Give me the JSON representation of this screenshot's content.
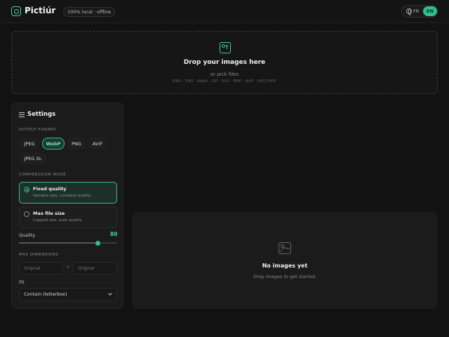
{
  "header": {
    "app_title": "Pictiúr",
    "badge": "100% local · offline",
    "lang_fr": "FR",
    "lang_en": "EN",
    "active_lang": "EN",
    "accent_color": "#2fbf8e"
  },
  "dropzone": {
    "title": "Drop your images here",
    "subtitle": "or pick files",
    "formats": "JPEG · PNG · WebP · GIF · SVG · BMP · AVIF · HEIC/HEIF",
    "icon": "image-upload-icon"
  },
  "settings": {
    "title": "Settings",
    "output_format_label": "OUTPUT FORMAT",
    "formats": [
      "JPEG",
      "WebP",
      "PNG",
      "AVIF",
      "JPEG XL"
    ],
    "selected_format": "WebP",
    "compression_mode_label": "COMPRESSION MODE",
    "modes": [
      {
        "title": "Fixed quality",
        "desc": "Variable size, constant quality",
        "selected": true
      },
      {
        "title": "Max file size",
        "desc": "Capped size, auto quality",
        "selected": false
      }
    ],
    "quality_label": "Quality",
    "quality_value": "80",
    "quality_fraction": 0.8,
    "max_dimensions_label": "MAX DIMENSIONS",
    "width_placeholder": "Original",
    "height_placeholder": "Original",
    "dim_separator": "×",
    "fit_label": "Fit",
    "fit_value": "Contain (letterbox)"
  },
  "empty_state": {
    "title": "No images yet",
    "subtitle": "Drop images to get started.",
    "icon": "image-icon"
  }
}
